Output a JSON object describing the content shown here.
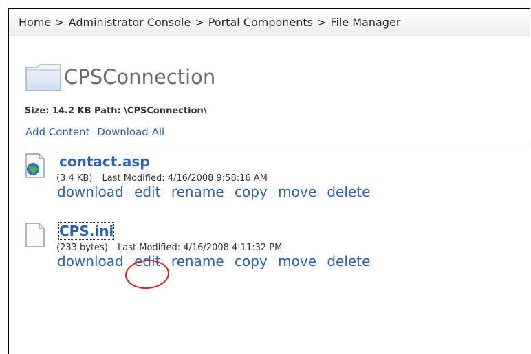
{
  "breadcrumb": {
    "items": [
      "Home",
      "Administrator Console",
      "Portal Components",
      "File Manager"
    ],
    "separator": ">"
  },
  "folder": {
    "title": "CPSConnection",
    "meta": "Size: 14.2 KB  Path: \\CPSConnection\\",
    "icon": "folder-icon",
    "actions": [
      "Add Content",
      "Download All"
    ]
  },
  "files": [
    {
      "name": "contact.asp",
      "icon": "web-file-icon",
      "size": "(3.4 KB)",
      "modified": "Last Modified: 4/16/2008 9:58:16 AM",
      "actions": [
        "download",
        "edit",
        "rename",
        "copy",
        "move",
        "delete"
      ]
    },
    {
      "name": "CPS.ini",
      "icon": "text-file-icon",
      "size": "(233 bytes)",
      "modified": "Last Modified: 4/16/2008 4:11:32 PM",
      "actions": [
        "download",
        "edit",
        "rename",
        "copy",
        "move",
        "delete"
      ]
    }
  ],
  "colors": {
    "link": "#2a63b8",
    "annotation": "#e31e1e"
  }
}
